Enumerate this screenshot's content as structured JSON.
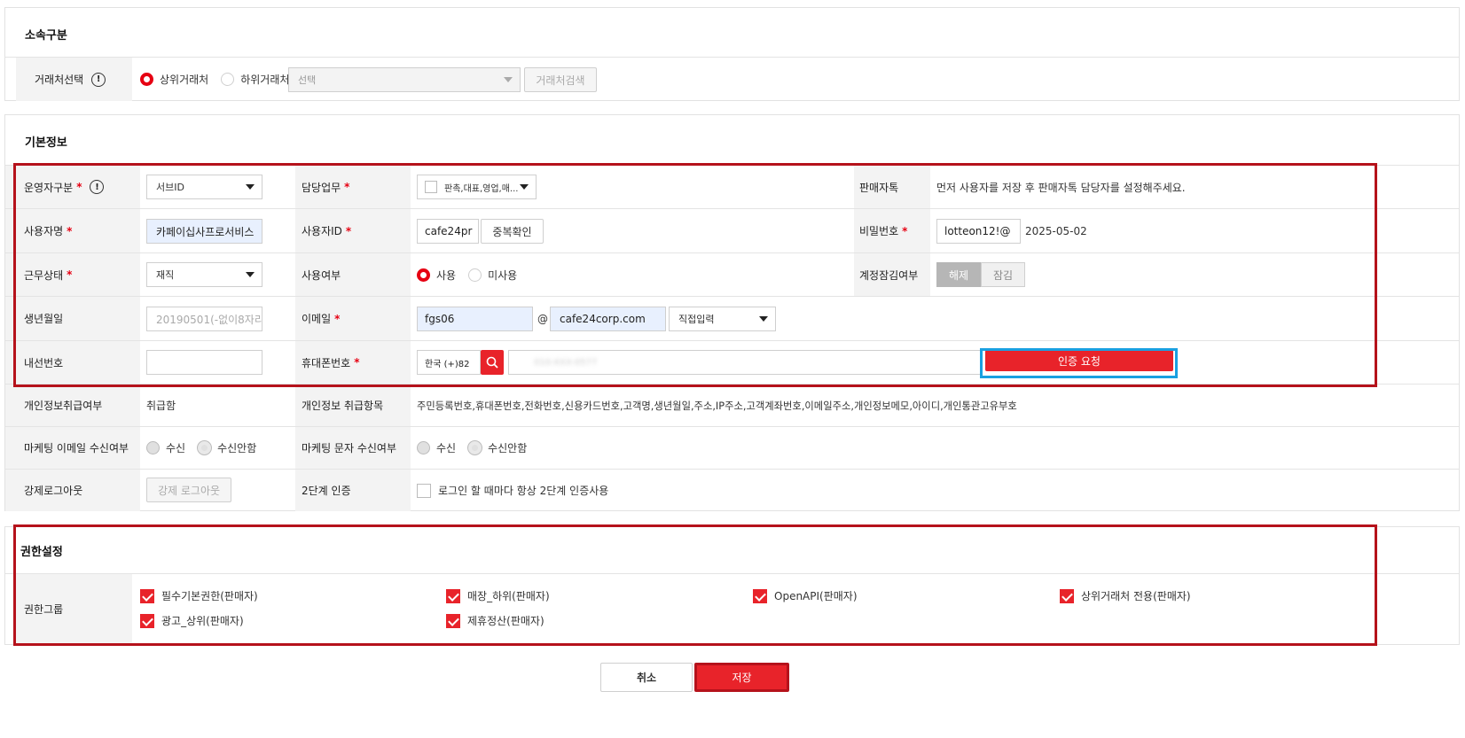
{
  "affiliation": {
    "title": "소속구분",
    "vendor_label": "거래처선택",
    "upper_vendor": "상위거래처",
    "lower_vendor": "하위거래처",
    "select_placeholder": "선택",
    "search_button": "거래처검색"
  },
  "basic": {
    "title": "기본정보",
    "operator_type": {
      "label": "운영자구분",
      "value": "서브ID"
    },
    "duty": {
      "label": "담당업무",
      "value": "판촉,대표,영업,매..."
    },
    "seller_talk": {
      "label": "판매자톡",
      "value": "먼저 사용자를 저장 후 판매자톡 담당자를 설정해주세요."
    },
    "user_name": {
      "label": "사용자명",
      "value": "카페이십사프로서비스"
    },
    "user_id": {
      "label": "사용자ID",
      "value": "cafe24pr",
      "check_button": "중복확인"
    },
    "password": {
      "label": "비밀번호",
      "value": "lotteon12!@",
      "date": "2025-05-02"
    },
    "work_status": {
      "label": "근무상태",
      "value": "재직"
    },
    "usage": {
      "label": "사용여부",
      "use": "사용",
      "unused": "미사용"
    },
    "account_lock": {
      "label": "계정잠김여부",
      "release": "해제",
      "lock": "잠김"
    },
    "birth": {
      "label": "생년월일",
      "placeholder": "20190501(-없이8자리)"
    },
    "email": {
      "label": "이메일",
      "local": "fgs06",
      "at": "@",
      "domain": "cafe24corp.com",
      "domain_select": "직접입력"
    },
    "extension": {
      "label": "내선번호",
      "value": ""
    },
    "mobile": {
      "label": "휴대폰번호",
      "country": "한국 (+)82",
      "number": "010-XXX-0577",
      "auth_button": "인증 요청"
    },
    "privacy_handle": {
      "label": "개인정보취급여부",
      "value": "취급함"
    },
    "privacy_items": {
      "label": "개인정보 취급항목",
      "value": "주민등록번호,휴대폰번호,전화번호,신용카드번호,고객명,생년월일,주소,IP주소,고객계좌번호,이메일주소,개인정보메모,아이디,개인통관고유부호"
    },
    "marketing_email": {
      "label": "마케팅 이메일 수신여부",
      "yes": "수신",
      "no": "수신안함"
    },
    "marketing_sms": {
      "label": "마케팅 문자 수신여부",
      "yes": "수신",
      "no": "수신안함"
    },
    "force_logout": {
      "label": "강제로그아웃",
      "button": "강제 로그아웃"
    },
    "two_factor": {
      "label": "2단계 인증",
      "text": "로그인 할 때마다 항상 2단계 인증사용"
    }
  },
  "permission": {
    "title": "권한설정",
    "group_label": "권한그룹",
    "items": [
      "필수기본권한(판매자)",
      "매장_하위(판매자)",
      "OpenAPI(판매자)",
      "상위거래처 전용(판매자)",
      "광고_상위(판매자)",
      "제휴정산(판매자)"
    ]
  },
  "footer": {
    "cancel": "취소",
    "save": "저장"
  },
  "colors": {
    "accent": "#e8232a",
    "frame": "#b5121b",
    "highlight": "#1aa0e0"
  }
}
